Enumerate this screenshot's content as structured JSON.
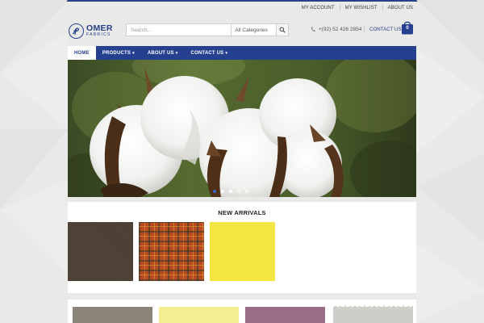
{
  "topnav": {
    "my_account": "MY ACCOUNT",
    "my_wishlist": "MY WISHLIST",
    "about_us": "ABOUT US"
  },
  "logo": {
    "name": "OMER",
    "subtitle": "FABRICS",
    "color": "#25408f"
  },
  "search": {
    "placeholder": "Search...",
    "category_selected": "All Categories",
    "icon": "search-icon"
  },
  "header": {
    "phone": "+(92) 52 426 2854",
    "phone_icon": "phone-icon",
    "contact_link": "CONTACT US",
    "cart_icon": "shopping-bag-icon",
    "cart_count": "0"
  },
  "nav": {
    "items": [
      {
        "label": "HOME",
        "active": true,
        "dropdown": false
      },
      {
        "label": "PRODUCTS",
        "active": false,
        "dropdown": true
      },
      {
        "label": "ABOUT US",
        "active": false,
        "dropdown": true
      },
      {
        "label": "CONTACT US",
        "active": false,
        "dropdown": true
      }
    ],
    "caret": "▾",
    "bar_color": "#25408f"
  },
  "slider": {
    "image": "cotton-boll-photo",
    "slides_total": 5,
    "active_slide": 1
  },
  "new_arrivals": {
    "title": "NEW ARRIVALS",
    "swatches": [
      {
        "name": "brown-fabric",
        "color": "#4c3f34"
      },
      {
        "name": "plaid-fabric",
        "color": "#b84a22"
      },
      {
        "name": "yellow-fabric",
        "color": "#f4e542"
      }
    ]
  },
  "second_row": {
    "swatches": [
      {
        "name": "taupe-fabric",
        "color": "#8b8479"
      },
      {
        "name": "lemon-fabric",
        "color": "#f3ee8f"
      },
      {
        "name": "mauve-fabric",
        "color": "#9a6c88"
      },
      {
        "name": "grey-fabric",
        "color": "#cfcdc7"
      }
    ]
  }
}
